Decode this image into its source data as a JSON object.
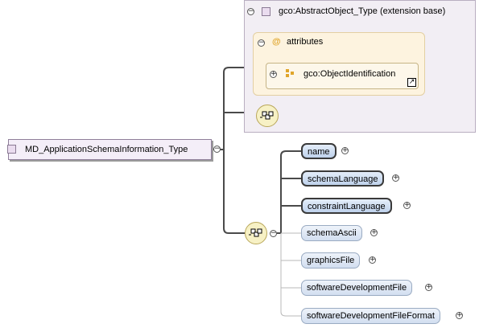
{
  "root_type": {
    "label": "MD_ApplicationSchemaInformation_Type",
    "toggle": "−"
  },
  "extension": {
    "label": "gco:AbstractObject_Type (extension base)",
    "toggle": "−"
  },
  "attributes": {
    "icon": "@",
    "label": "attributes",
    "toggle": "−"
  },
  "attribute_group": {
    "label": "gco:ObjectIdentification",
    "toggle": "+",
    "link_icon": "↗"
  },
  "elements": [
    {
      "label": "name",
      "toggle": "+",
      "kind": "required"
    },
    {
      "label": "schemaLanguage",
      "toggle": "+",
      "kind": "required"
    },
    {
      "label": "constraintLanguage",
      "toggle": "+",
      "kind": "required"
    },
    {
      "label": "schemaAscii",
      "toggle": "+",
      "kind": "optional"
    },
    {
      "label": "graphicsFile",
      "toggle": "+",
      "kind": "optional"
    },
    {
      "label": "softwareDevelopmentFile",
      "toggle": "+",
      "kind": "optional"
    },
    {
      "label": "softwareDevelopmentFileFormat",
      "toggle": "+",
      "kind": "optional"
    }
  ],
  "sequence_toggle": "−",
  "colors": {
    "type_fill": "#f4eef8",
    "extension_fill": "#f2eef4",
    "attributes_fill": "#fdf3df",
    "sequence_fill": "#f7f1c5",
    "element_fill": "#bfd2ec"
  }
}
